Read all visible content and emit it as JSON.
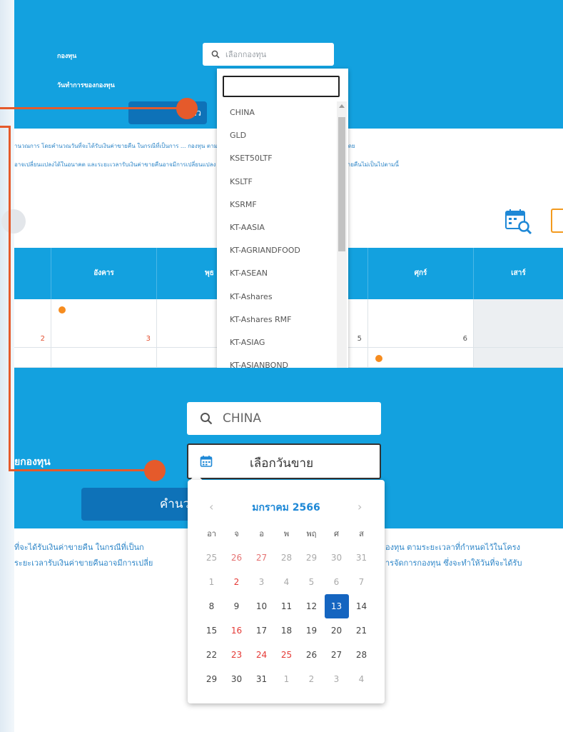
{
  "top_form": {
    "fund_label": "กองทุน",
    "date_label": "วันทำการของกองทุน",
    "search_placeholder": "เลือกกองทุน",
    "calc_button": "คำนว"
  },
  "top_description": [
    "ำนวณการ โดยคำนวณวันที่จะได้รับเงินค่าขายคืน ในกรณีที่เป็นการ ... กองทุน ตามระยะเวลาที่กำหนดไว้ในโครงการจัดการกองทุนรวม โดย",
    "อาจเปลี่ยนแปลงได้ในอนาคต และระยะเวลารับเงินค่าขายคืนอาจมีการเปลี่ยนแปลง ... การจัดการกองทุน ซึ่งจะทำให้วันที่จะได้รับเงินค่าขายคืนไม่เป็นไปตามนี้"
  ],
  "calendar": {
    "headers": [
      "อังคาร",
      "พุธ",
      "",
      "",
      "ศุกร์",
      "เสาร์"
    ],
    "row1": [
      "2",
      "3",
      "5",
      "6"
    ]
  },
  "dropdown": {
    "items": [
      "CHINA",
      "GLD",
      "KSET50LTF",
      "KSLTF",
      "KSRMF",
      "KT-AASIA",
      "KT-AGRIANDFOOD",
      "KT-ASEAN",
      "KT-Ashares",
      "KT-Ashares RMF",
      "KT-ASIAG",
      "KT-ASIANBOND"
    ]
  },
  "bottom_form": {
    "search_value": "CHINA",
    "date_placeholder": "เลือกวันขาย",
    "fund_label": "ยกองทุน",
    "calc_button": "คำนว"
  },
  "bottom_description": [
    "ที่จะได้รับเงินค่าขายคืน ในกรณีที่เป็นก",
    "ระยะเวลารับเงินค่าขายคืนอาจมีการเปลี่ย",
    "องทุน ตามระยะเวลาที่กำหนดไว้ในโครง",
    "ารจัดการกองทุน ซึ่งจะทำให้วันที่จะได้รับ"
  ],
  "datepicker": {
    "title": "มกราคม 2566",
    "prev": "‹",
    "next": "›",
    "dow": [
      "อา",
      "จ",
      "อ",
      "พ",
      "พฤ",
      "ศ",
      "ส"
    ],
    "weeks": [
      [
        "25",
        "26",
        "27",
        "28",
        "29",
        "30",
        "31"
      ],
      [
        "1",
        "2",
        "3",
        "4",
        "5",
        "6",
        "7"
      ],
      [
        "8",
        "9",
        "10",
        "11",
        "12",
        "13",
        "14"
      ],
      [
        "15",
        "16",
        "17",
        "18",
        "19",
        "20",
        "21"
      ],
      [
        "22",
        "23",
        "24",
        "25",
        "26",
        "27",
        "28"
      ],
      [
        "29",
        "30",
        "31",
        "1",
        "2",
        "3",
        "4"
      ]
    ],
    "selected": "13",
    "colors": {
      "accent": "#1e88d6",
      "selected_bg": "#1565c0",
      "holiday": "#e53935"
    }
  },
  "colors": {
    "panel": "#13a1df",
    "button": "#0e72b8",
    "connector": "#e55a2b",
    "dot": "#f68c1f"
  }
}
